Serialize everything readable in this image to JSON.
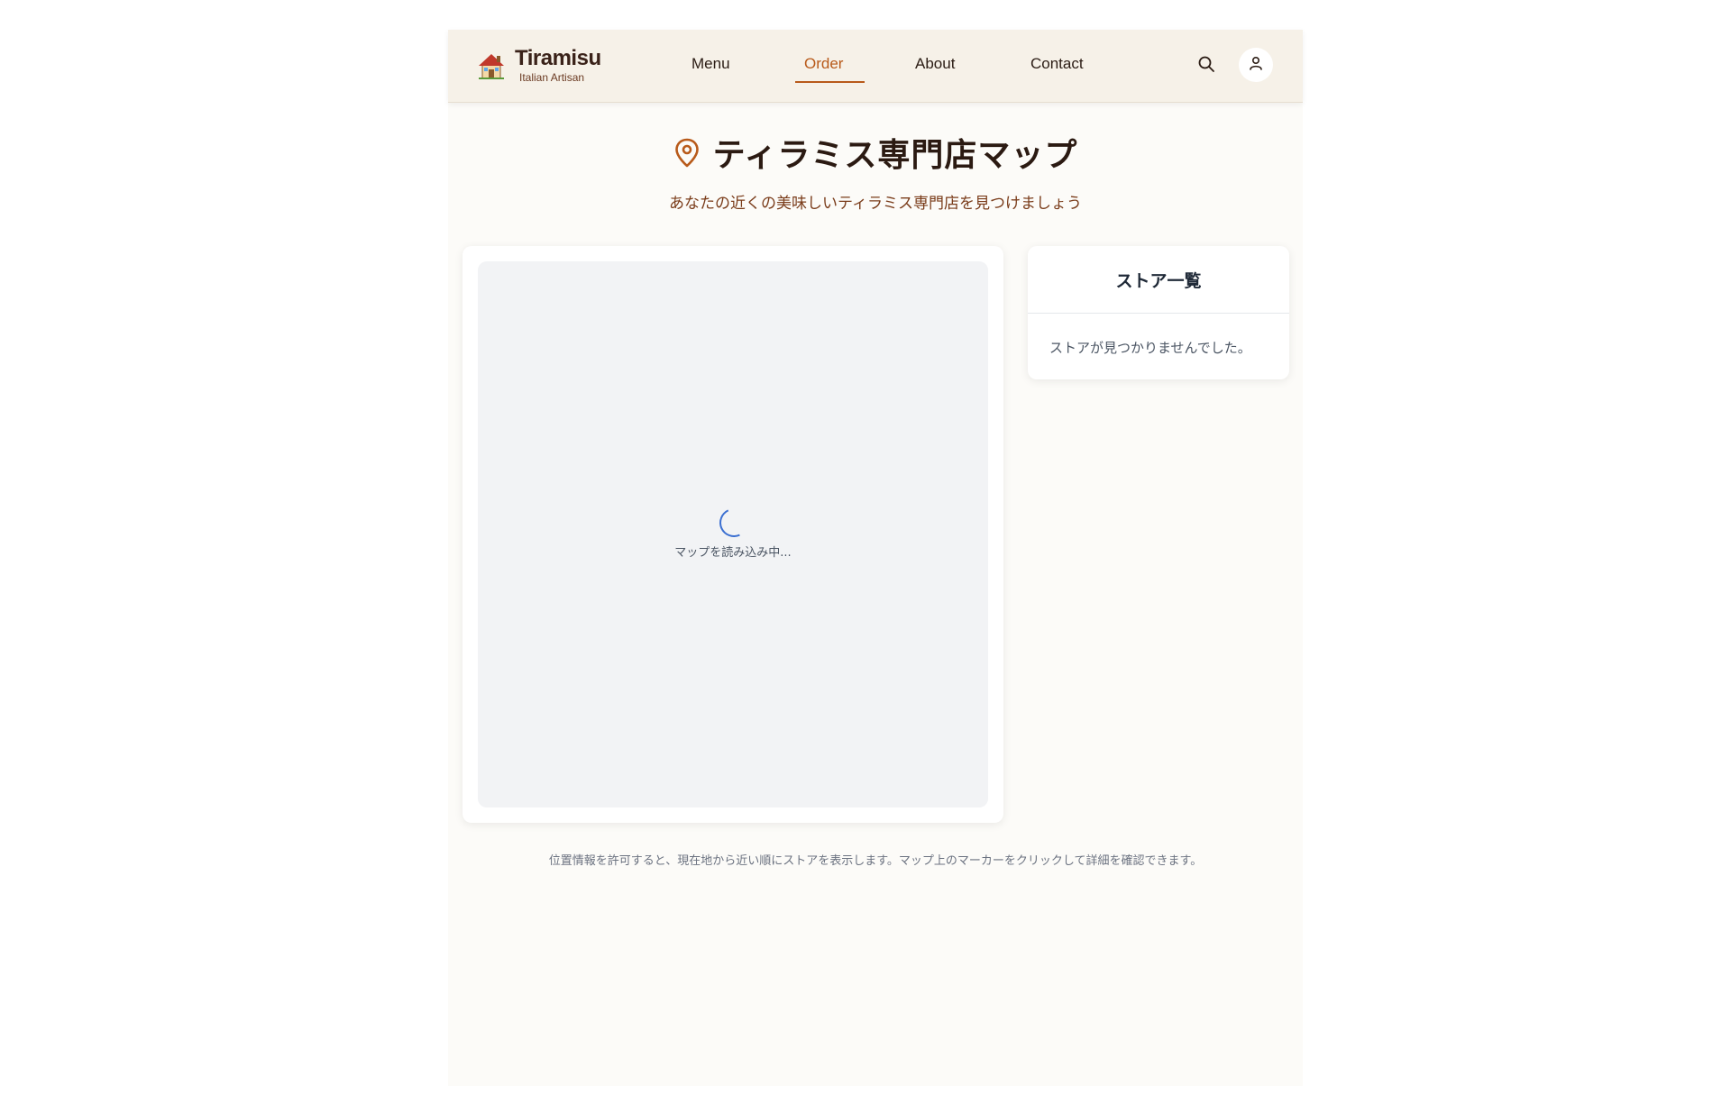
{
  "header": {
    "logo_title": "Tiramisu",
    "logo_subtitle": "Italian Artisan",
    "nav": [
      {
        "label": "Menu",
        "active": false
      },
      {
        "label": "Order",
        "active": true
      },
      {
        "label": "About",
        "active": false
      },
      {
        "label": "Contact",
        "active": false
      }
    ],
    "icons": [
      "house-icon",
      "search-icon",
      "user-icon"
    ]
  },
  "main": {
    "title": "ティラミス専門店マップ",
    "title_icon": "map-pin-icon",
    "subtitle": "あなたの近くの美味しいティラミス専門店を見つけましょう",
    "map": {
      "loading_text": "マップを読み込み中..."
    },
    "store_list": {
      "heading": "ストア一覧",
      "empty_text": "ストアが見つかりませんでした。"
    },
    "footer_note": "位置情報を許可すると、現在地から近い順にストアを表示します。マップ上のマーカーをクリックして詳細を確認できます。"
  },
  "colors": {
    "accent": "#b85a1a",
    "header_bg": "#f6f1e8",
    "page_bg": "#fcfbf8",
    "title_text": "#2b1a12",
    "spinner": "#3b6fd1"
  }
}
